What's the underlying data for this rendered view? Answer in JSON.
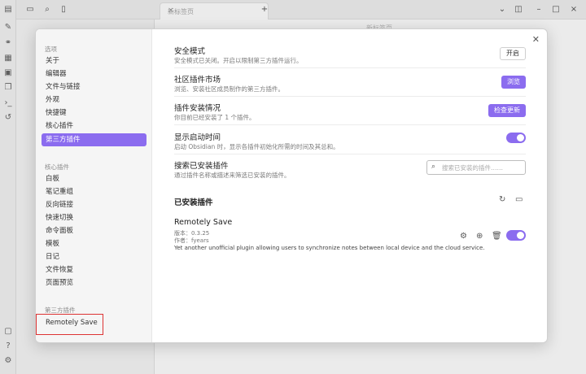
{
  "app": {
    "tab_label": "新标签页",
    "bg_title": "新标签页"
  },
  "sidebar": {
    "options_header": "选项",
    "options": [
      {
        "label": "关于"
      },
      {
        "label": "编辑器"
      },
      {
        "label": "文件与链接"
      },
      {
        "label": "外观"
      },
      {
        "label": "快捷键"
      },
      {
        "label": "核心插件"
      },
      {
        "label": "第三方插件",
        "active": true
      }
    ],
    "core_header": "核心插件",
    "core": [
      {
        "label": "白板"
      },
      {
        "label": "笔记重组"
      },
      {
        "label": "反向链接"
      },
      {
        "label": "快速切换"
      },
      {
        "label": "命令面板"
      },
      {
        "label": "模板"
      },
      {
        "label": "日记"
      },
      {
        "label": "文件恢复"
      },
      {
        "label": "页面预览"
      }
    ],
    "third_header": "第三方插件",
    "third": [
      {
        "label": "Remotely Save"
      }
    ]
  },
  "settings": [
    {
      "title": "安全模式",
      "desc": "安全模式已关闭。开启以限制第三方插件运行。",
      "button": "开启"
    },
    {
      "title": "社区插件市场",
      "desc": "浏览、安装社区成员制作的第三方插件。",
      "button": "浏览"
    },
    {
      "title": "插件安装情况",
      "desc": "你目前已经安装了 1 个插件。",
      "button": "检查更新"
    },
    {
      "title": "显示启动时间",
      "desc": "启动 Obsidian 时，显示各插件初始化所需的时间及其总和。",
      "toggle": true
    },
    {
      "title": "搜索已安装插件",
      "desc": "通过插件名称或描述来筛选已安装的插件。",
      "placeholder": "搜索已安装的插件……"
    }
  ],
  "installed": {
    "header": "已安装插件",
    "plugin": {
      "name": "Remotely Save",
      "version": "版本：0.3.25",
      "author": "作者：fyears",
      "description": "Yet another unofficial plugin allowing users to synchronize notes between local device and the cloud service.",
      "enabled": true
    }
  }
}
